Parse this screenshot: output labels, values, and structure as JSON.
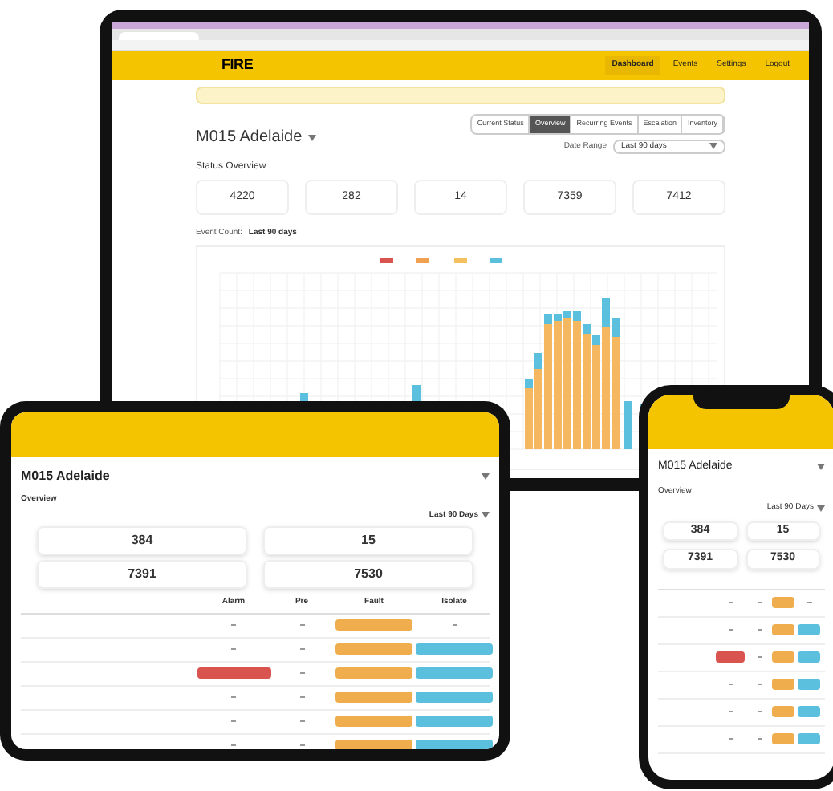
{
  "laptop": {
    "logo": "FIRE",
    "nav": [
      {
        "label": "Dashboard",
        "selected": true
      },
      {
        "label": "Events",
        "selected": false
      },
      {
        "label": "Settings",
        "selected": false
      },
      {
        "label": "Logout",
        "selected": false
      }
    ],
    "site_title": "M015 Adelaide",
    "tabs": [
      {
        "label": "Current Status",
        "selected": false
      },
      {
        "label": "Overview",
        "selected": true
      },
      {
        "label": "Recurring Events",
        "selected": false
      },
      {
        "label": "Escalation",
        "selected": false
      },
      {
        "label": "Inventory",
        "selected": false
      }
    ],
    "date_range": {
      "label": "Date Range",
      "value": "Last 90 days"
    },
    "status_heading": "Status Overview",
    "stats": [
      "4220",
      "282",
      "14",
      "7359",
      "7412"
    ],
    "chart_heading": "Event Count:",
    "chart_range": "Last 90 days"
  },
  "tablet": {
    "title": "M015 Adelaide",
    "section": "Overview",
    "range": "Last 90 Days",
    "stats": [
      "384",
      "15",
      "7391",
      "7530"
    ],
    "columns": [
      "Alarm",
      "Pre",
      "Fault",
      "Isolate"
    ],
    "rows": [
      {
        "alarm": false,
        "fault": true,
        "isolate": false
      },
      {
        "alarm": false,
        "fault": true,
        "isolate": true
      },
      {
        "alarm": true,
        "fault": true,
        "isolate": true
      },
      {
        "alarm": false,
        "fault": true,
        "isolate": true
      },
      {
        "alarm": false,
        "fault": true,
        "isolate": true
      },
      {
        "alarm": false,
        "fault": true,
        "isolate": true
      }
    ]
  },
  "phone": {
    "title": "M015 Adelaide",
    "section": "Overview",
    "range": "Last 90 Days",
    "stats": [
      "384",
      "15",
      "7391",
      "7530"
    ],
    "rows": [
      {
        "alarm": false,
        "fault": true,
        "isolate": false
      },
      {
        "alarm": false,
        "fault": true,
        "isolate": true
      },
      {
        "alarm": true,
        "fault": true,
        "isolate": true
      },
      {
        "alarm": false,
        "fault": true,
        "isolate": true
      },
      {
        "alarm": false,
        "fault": true,
        "isolate": true
      },
      {
        "alarm": false,
        "fault": true,
        "isolate": true
      }
    ]
  }
}
